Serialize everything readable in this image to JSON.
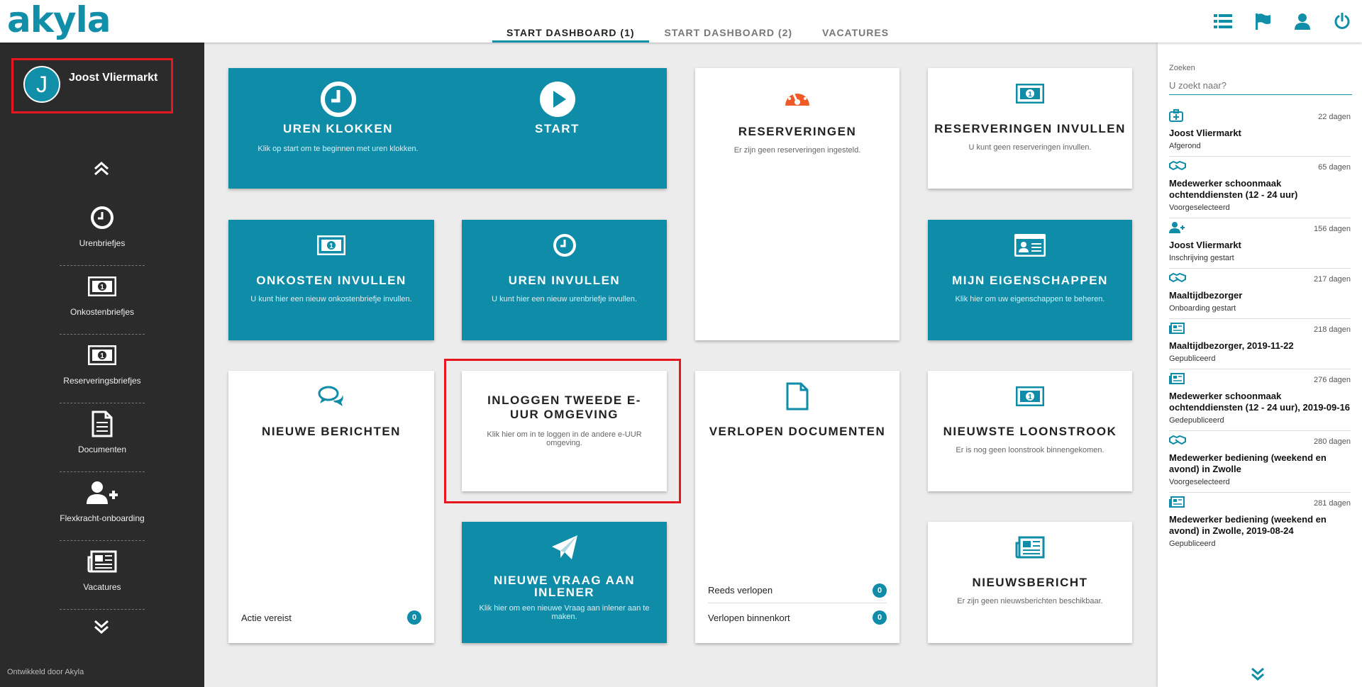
{
  "app": {
    "logo": "akyla"
  },
  "tabs": [
    {
      "label": "START DASHBOARD (1)"
    },
    {
      "label": "START DASHBOARD (2)"
    },
    {
      "label": "VACATURES"
    }
  ],
  "top_icons": [
    "list-icon",
    "flag-icon",
    "user-icon",
    "power-icon"
  ],
  "sidebar": {
    "user": {
      "initial": "J",
      "name": "Joost Vliermarkt"
    },
    "items": [
      {
        "label": "Urenbriefjes",
        "icon": "clock-icon"
      },
      {
        "label": "Onkostenbriefjes",
        "icon": "money-icon"
      },
      {
        "label": "Reserveringsbriefjes",
        "icon": "money-icon"
      },
      {
        "label": "Documenten",
        "icon": "document-icon"
      },
      {
        "label": "Flexkracht-onboarding",
        "icon": "user-plus-icon"
      },
      {
        "label": "Vacatures",
        "icon": "newspaper-icon"
      }
    ],
    "credit": "Ontwikkeld door Akyla"
  },
  "tiles": {
    "uren_klokken": {
      "title": "UREN KLOKKEN",
      "desc": "Klik op start om te beginnen met uren klokken.",
      "start": "START"
    },
    "reserveringen": {
      "title": "RESERVERINGEN",
      "desc": "Er zijn geen reserveringen ingesteld."
    },
    "reserveringen_invullen": {
      "title": "RESERVERINGEN INVULLEN",
      "desc": "U kunt geen reserveringen invullen."
    },
    "onkosten_invullen": {
      "title": "ONKOSTEN INVULLEN",
      "desc": "U kunt hier een nieuw onkostenbriefje invullen."
    },
    "uren_invullen": {
      "title": "UREN INVULLEN",
      "desc": "U kunt hier een nieuw urenbriefje invullen."
    },
    "mijn_eigenschappen": {
      "title": "MIJN EIGENSCHAPPEN",
      "desc": "Klik hier om uw eigenschappen te beheren."
    },
    "nieuwe_berichten": {
      "title": "NIEUWE BERICHTEN",
      "row_label": "Actie vereist",
      "row_count": "0"
    },
    "inloggen": {
      "title": "INLOGGEN TWEEDE E-UUR OMGEVING",
      "desc": "Klik hier om in te loggen in de andere e-UUR omgeving."
    },
    "verlopen_documenten": {
      "title": "VERLOPEN DOCUMENTEN",
      "row1_label": "Reeds verlopen",
      "row1_count": "0",
      "row2_label": "Verlopen binnenkort",
      "row2_count": "0"
    },
    "nieuwste_loonstrook": {
      "title": "NIEUWSTE LOONSTROOK",
      "desc": "Er is nog geen loonstrook binnengekomen."
    },
    "nieuwe_vraag": {
      "title": "NIEUWE VRAAG AAN INLENER",
      "desc": "Klik hier om een nieuwe Vraag aan inlener aan te maken."
    },
    "nieuwsbericht": {
      "title": "NIEUWSBERICHT",
      "desc": "Er zijn geen nieuwsberichten beschikbaar."
    }
  },
  "search": {
    "label": "Zoeken",
    "placeholder": "U zoekt naar?"
  },
  "feed": [
    {
      "icon": "medical-case-icon",
      "days": "22 dagen",
      "title": "Joost Vliermarkt",
      "status": "Afgerond"
    },
    {
      "icon": "handshake-icon",
      "days": "65 dagen",
      "title": "Medewerker schoonmaak ochtenddiensten (12 - 24 uur)",
      "status": "Voorgeselecteerd"
    },
    {
      "icon": "user-plus-icon",
      "days": "156 dagen",
      "title": "Joost Vliermarkt",
      "status": "Inschrijving gestart"
    },
    {
      "icon": "handshake-icon",
      "days": "217 dagen",
      "title": "Maaltijdbezorger",
      "status": "Onboarding gestart"
    },
    {
      "icon": "newspaper-icon",
      "days": "218 dagen",
      "title": "Maaltijdbezorger, 2019-11-22",
      "status": "Gepubliceerd"
    },
    {
      "icon": "newspaper-icon",
      "days": "276 dagen",
      "title": "Medewerker schoonmaak ochtenddiensten (12 - 24 uur), 2019-09-16",
      "status": "Gedepubliceerd"
    },
    {
      "icon": "handshake-icon",
      "days": "280 dagen",
      "title": "Medewerker bediening (weekend en avond) in Zwolle",
      "status": "Voorgeselecteerd"
    },
    {
      "icon": "newspaper-icon",
      "days": "281 dagen",
      "title": "Medewerker bediening (weekend en avond) in Zwolle, 2019-08-24",
      "status": "Gepubliceerd"
    }
  ]
}
